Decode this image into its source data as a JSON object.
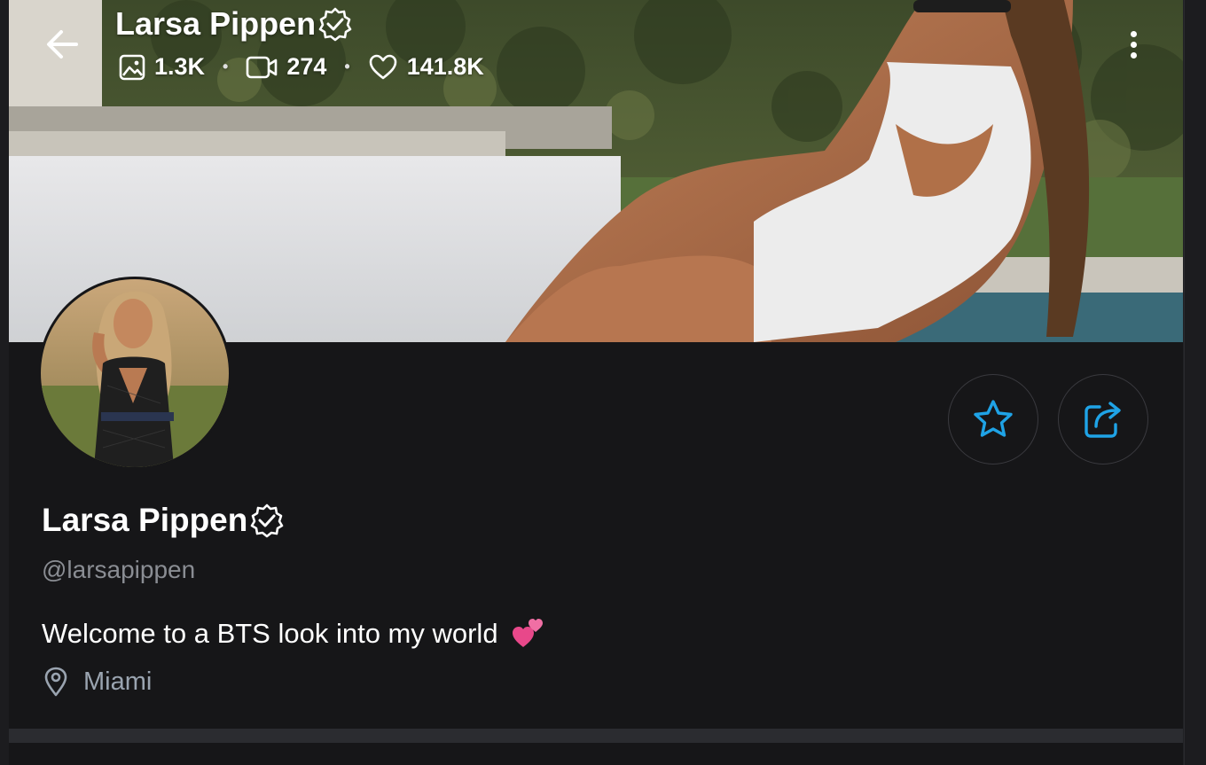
{
  "profile": {
    "name": "Larsa Pippen",
    "handle": "@larsapippen",
    "bio": "Welcome to a BTS look into my world",
    "bio_emoji": "two-hearts",
    "location": "Miami",
    "verified": true
  },
  "header": {
    "name": "Larsa Pippen",
    "stats": {
      "photos": "1.3K",
      "videos": "274",
      "likes": "141.8K"
    },
    "separator": "•"
  },
  "icons": {
    "back": "arrow-left-icon",
    "more": "more-vertical-icon",
    "favorite": "star-icon",
    "share": "share-icon",
    "verified": "verified-badge-icon",
    "photos": "image-icon",
    "videos": "video-icon",
    "likes": "heart-icon",
    "location": "map-pin-icon"
  },
  "colors": {
    "background": "#161618",
    "accent": "#1fa3e6",
    "muted_text": "#8a8d93",
    "location_text": "#9aa4b0",
    "heart_emoji": "#e8488a"
  }
}
